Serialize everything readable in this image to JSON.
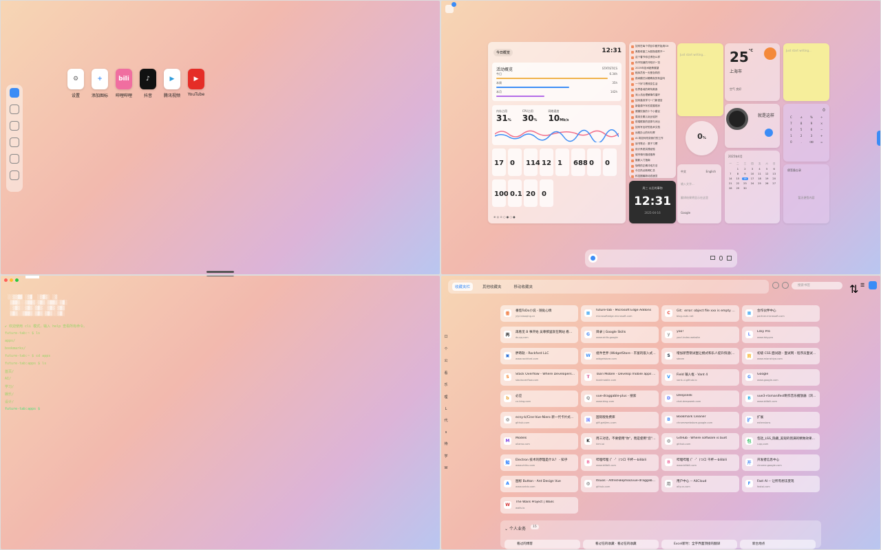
{
  "q1": {
    "apps": [
      {
        "icon": "gear-icon",
        "label": "设置",
        "color": "#ffffff",
        "fg": "#666"
      },
      {
        "icon": "plus-icon",
        "label": "添加图标",
        "color": "#ffffff",
        "fg": "#3b8cf6"
      },
      {
        "icon": "bilibili-icon",
        "label": "哔哩哔哩",
        "color": "#f06ea0",
        "fg": "#fff"
      },
      {
        "icon": "tiktok-icon",
        "label": "抖音",
        "color": "#111111",
        "fg": "#fff"
      },
      {
        "icon": "video-icon",
        "label": "腾讯视频",
        "color": "#ffffff",
        "fg": "#2d9cdb"
      },
      {
        "icon": "youtube-icon",
        "label": "YouTube",
        "color": "#e52d27",
        "fg": "#fff"
      }
    ]
  },
  "q2": {
    "badge": "1",
    "main": {
      "chip": "今日概览",
      "clock": "12:31",
      "section": "活动概览",
      "section_sub": "STATISTICS",
      "bars": [
        {
          "label": "今日",
          "value": "6.34h",
          "pct": 0.92,
          "color": "#f0b24a"
        },
        {
          "label": "本周",
          "value": "35h",
          "pct": 0.6,
          "color": "#3b8cf6"
        },
        {
          "label": "本月",
          "value": "142h",
          "pct": 0.4,
          "color": "#b36be8"
        }
      ],
      "metrics": [
        {
          "label": "内存占用",
          "value": "31",
          "unit": "%"
        },
        {
          "label": "CPU占用",
          "value": "30",
          "unit": "%"
        },
        {
          "label": "网络速度",
          "value": "10",
          "unit": "Mb/s"
        }
      ],
      "counters": [
        "17",
        "0",
        "114",
        "12",
        "1",
        "688",
        "0",
        "0"
      ],
      "counters2": [
        "100",
        "0.1",
        "20",
        "0"
      ]
    },
    "news": [
      "如何在每个项目中都开始用Git",
      "美股收盘三大股指涨跌不一",
      "这个春节你过得怎么样",
      "你不知道的冷知识一览",
      "2025年技术趋势展望",
      "程序员的一天是怎样的",
      "夜间模式对眼睛真的有益吗",
      "一个好习惯改变生活",
      "世界各地的奇特美食",
      "深入浅出理解事件循环",
      "如何高效学习一门新语言",
      "新能源汽车的发展现状",
      "健康饮食的十个小建议",
      "周末去哪儿玩比较好",
      "前端框架的选择与对比",
      "如何写出好的技术文档",
      "远程办公的利与弊",
      "AI 将如何改变我们的工作",
      "读书笔记：原子习惯",
      "设计系统实践经验",
      "城市骑行路线推荐",
      "摄影入门指南",
      "咖啡的正确冲泡方法",
      "今日热点新闻汇总",
      "科技圈最新动态速览",
      "每周精选好文推荐"
    ],
    "darkclock": {
      "label": "周三 以后的事物",
      "time": "12:31",
      "date": "2025-04-16"
    },
    "note1": {
      "placeholder": "Just start writing..."
    },
    "circle": {
      "value": "0",
      "unit": "%"
    },
    "weather": {
      "temp": "25",
      "unit": "°C",
      "city": "上海市",
      "desc": "晴",
      "extra": "空气 良好"
    },
    "note2": {
      "placeholder": "Just start writing..."
    },
    "music": {
      "title": "就是这样"
    },
    "calc": {
      "display": "0",
      "keys": [
        "C",
        "±",
        "%",
        "÷",
        "7",
        "8",
        "9",
        "×",
        "4",
        "5",
        "6",
        "−",
        "1",
        "2",
        "3",
        "+",
        "0",
        ".",
        "⌫",
        "="
      ]
    },
    "translate": {
      "from": "中文",
      "to": "English",
      "placeholder": "输入文字...",
      "hint": "翻译结果将显示在这里",
      "engine": "Google"
    },
    "calendar": {
      "title": "2025年4月",
      "days": [
        "一",
        "二",
        "三",
        "四",
        "五",
        "六",
        "日"
      ],
      "dates": [
        "",
        "1",
        "2",
        "3",
        "4",
        "5",
        "6",
        "7",
        "8",
        "9",
        "10",
        "11",
        "12",
        "13",
        "14",
        "15",
        "16",
        "17",
        "18",
        "19",
        "20",
        "21",
        "22",
        "23",
        "24",
        "25",
        "26",
        "27",
        "28",
        "29",
        "30",
        "",
        "",
        "",
        ""
      ]
    },
    "noteboard": {
      "title": "便签备忘录",
      "empty": "暂无便签内容"
    }
  },
  "q3": {
    "lines": [
      {
        "text": "✔ 欢迎使用 cli 模式，输入 help 查看所有命令。",
        "color": "#9bd46a"
      },
      {
        "text": "future-tab:~ $ ls",
        "color": "#9bd46a"
      },
      {
        "text": "  apps/",
        "color": "#9bd46a"
      },
      {
        "text": "  bookmarks/",
        "color": "#9bd46a"
      },
      {
        "text": "future-tab:~ $ cd apps",
        "color": "#9bd46a"
      },
      {
        "text": "future-tab:apps $ ls",
        "color": "#9bd46a"
      },
      {
        "text": "  首页/",
        "color": "#9bd46a"
      },
      {
        "text": "  AI/",
        "color": "#9bd46a"
      },
      {
        "text": "  学习/",
        "color": "#9bd46a"
      },
      {
        "text": "  娱乐/",
        "color": "#9bd46a"
      },
      {
        "text": "  设计/",
        "color": "#9bd46a"
      },
      {
        "text": "future-tab:apps $",
        "color": "#4fe07a"
      }
    ]
  },
  "q4": {
    "tabs": [
      "收藏夹栏",
      "其他收藏夹",
      "移动收藏夹"
    ],
    "search_placeholder": "搜索书签",
    "side": [
      "口",
      "个",
      "公",
      "看",
      "乐",
      "理",
      "L",
      "代",
      "s",
      "待",
      "学",
      "W"
    ],
    "bookmarks": [
      {
        "t": "番茄ToDo小说 - 随处心情",
        "u": "yiyi.biaoqing.cn",
        "c": "#f0773a",
        "i": "番"
      },
      {
        "t": "future-tab - Microsoft Edge Addons",
        "u": "microsoftedge.microsoft.com",
        "c": "#2c9ef0",
        "i": "▦"
      },
      {
        "t": "Git：error: object file xxx is empty 错误问题...",
        "u": "blog.csdn.net",
        "c": "#e74a3b",
        "i": "C"
      },
      {
        "t": "合作伙伴中心",
        "u": "partner.microsoft.com",
        "c": "#2c9ef0",
        "i": "▦"
      },
      {
        "t": "再看见 B 事开始 吴尊那里就在网站 看到报...",
        "u": "ds.qq.com",
        "c": "#333",
        "i": "再"
      },
      {
        "t": "目录 | Google Skills",
        "u": "www.skills.google",
        "c": "#4285f4",
        "i": "G"
      },
      {
        "t": "yoo!",
        "u": "yoo!.index.website",
        "c": "#999",
        "i": "y"
      },
      {
        "t": "Lsky Pro",
        "u": "www.lsky.pro",
        "c": "#6b8cff",
        "i": "L"
      },
      {
        "t": "胖奇轨 - Rockford LLC",
        "u": "www.rockford.com",
        "c": "#2b6fd6",
        "i": "▣"
      },
      {
        "t": "组件世界 (WidgetStore - 丰富的嵌入式小组...",
        "u": "widgetstore.com",
        "c": "#3b8cf6",
        "i": "W"
      },
      {
        "t": "增加新营销试图让模式和乐人提升快速(ASI)...",
        "u": "steam",
        "c": "#1b2838",
        "i": "S"
      },
      {
        "t": "初级 CSS 面试题 - 面试网 - 程序员面试题...",
        "u": "www.mianshiya.com",
        "c": "#f7b733",
        "i": "面"
      },
      {
        "t": "Stack Overflow - Where Developers Learn, S...",
        "u": "stackoverflow.com",
        "c": "#f48024",
        "i": "S"
      },
      {
        "t": "Taari Mobile - Develop mobile apps with Ja...",
        "u": "taarimobile.com",
        "c": "#d94c8b",
        "i": "T"
      },
      {
        "t": "Field 输入框 - Vant 4",
        "u": "vant-ui.github.io",
        "c": "#1989fa",
        "i": "V"
      },
      {
        "t": "Google",
        "u": "www.google.com",
        "c": "#4285f4",
        "i": "G"
      },
      {
        "t": "必应",
        "u": "cn.bing.com",
        "c": "#e89f2c",
        "i": "b"
      },
      {
        "t": "vue-draggable-plus - 搜索",
        "u": "www.bing.com",
        "c": "#888",
        "i": "Q"
      },
      {
        "t": "Deepseek",
        "u": "chat.deepseek.com",
        "c": "#4d6bfe",
        "i": "D"
      },
      {
        "t": "vue3+tsmanifest制作音乐播放器（浏览器插...",
        "u": "www.bilibili.com",
        "c": "#23ade5",
        "i": "B"
      },
      {
        "t": "ecny-k/Cine-Vue-Niero 新一代卡片式管理...",
        "u": "github.com",
        "c": "#222",
        "i": "◎"
      },
      {
        "t": "国际版免费库",
        "u": "gift.getjimu.com",
        "c": "#7b8cff",
        "i": "国"
      },
      {
        "t": "Bookmark Cleaner",
        "u": "chromewebstore.google.com",
        "c": "#4285f4",
        "i": "B"
      },
      {
        "t": "扩展",
        "u": "extensions",
        "c": "#4285f4",
        "i": "扩"
      },
      {
        "t": "Models",
        "u": "ollama.com",
        "c": "#7a3fe4",
        "i": "M"
      },
      {
        "t": "周三对话，不要使用\"你\"，而是使用\"您\"。(LPU)...",
        "u": "kimi.ai",
        "c": "#222",
        "i": "K"
      },
      {
        "t": "GitHub · Where software is built",
        "u": "github.com",
        "c": "#222",
        "i": "◎"
      },
      {
        "t": "包括_LSS_隐藏_美观的饱满的精致效果...",
        "u": "v.qq.com",
        "c": "#20b954",
        "i": "包"
      },
      {
        "t": "Electron 技术的原理是什么？ - 知乎",
        "u": "www.zhihu.com",
        "c": "#0066ff",
        "i": "知"
      },
      {
        "t": "哔哩哔哩 (゜-゜)つロ 干杯~-bilibili",
        "u": "www.bilibili.com",
        "c": "#f06ea0",
        "i": "B"
      },
      {
        "t": "哔哩哔哩 (゜-゜)つロ 干杯~-bilibili",
        "u": "www.bilibili.com",
        "c": "#f06ea0",
        "i": "B"
      },
      {
        "t": "开发者信息中心",
        "u": "chrome.google.com",
        "c": "#4285f4",
        "i": "开"
      },
      {
        "t": "图标 Button - Ant Design Vue",
        "u": "www.antdv.com",
        "c": "#1677ff",
        "i": "A"
      },
      {
        "t": "Itsuos - Alfred-Bephoo/vue-draggable-plus",
        "u": "github.com",
        "c": "#222",
        "i": "◎"
      },
      {
        "t": "用户中心 -- AliCloud",
        "u": "aliyun.com",
        "c": "#888",
        "i": "用"
      },
      {
        "t": "Fast AI -- 让所有想法变现",
        "u": "fastai.com",
        "c": "#3b8cf6",
        "i": "F"
      },
      {
        "t": "The Wails Project | Wails",
        "u": "wails.io",
        "c": "#d32f2f",
        "i": "W"
      }
    ],
    "personal": {
      "title": "个人业务",
      "count": "15",
      "items": [
        "看过的博客",
        "看过在的收藏 · 看过在的收藏",
        "Excel新时：全字界面顶接的翻译",
        "新台地点"
      ]
    }
  }
}
